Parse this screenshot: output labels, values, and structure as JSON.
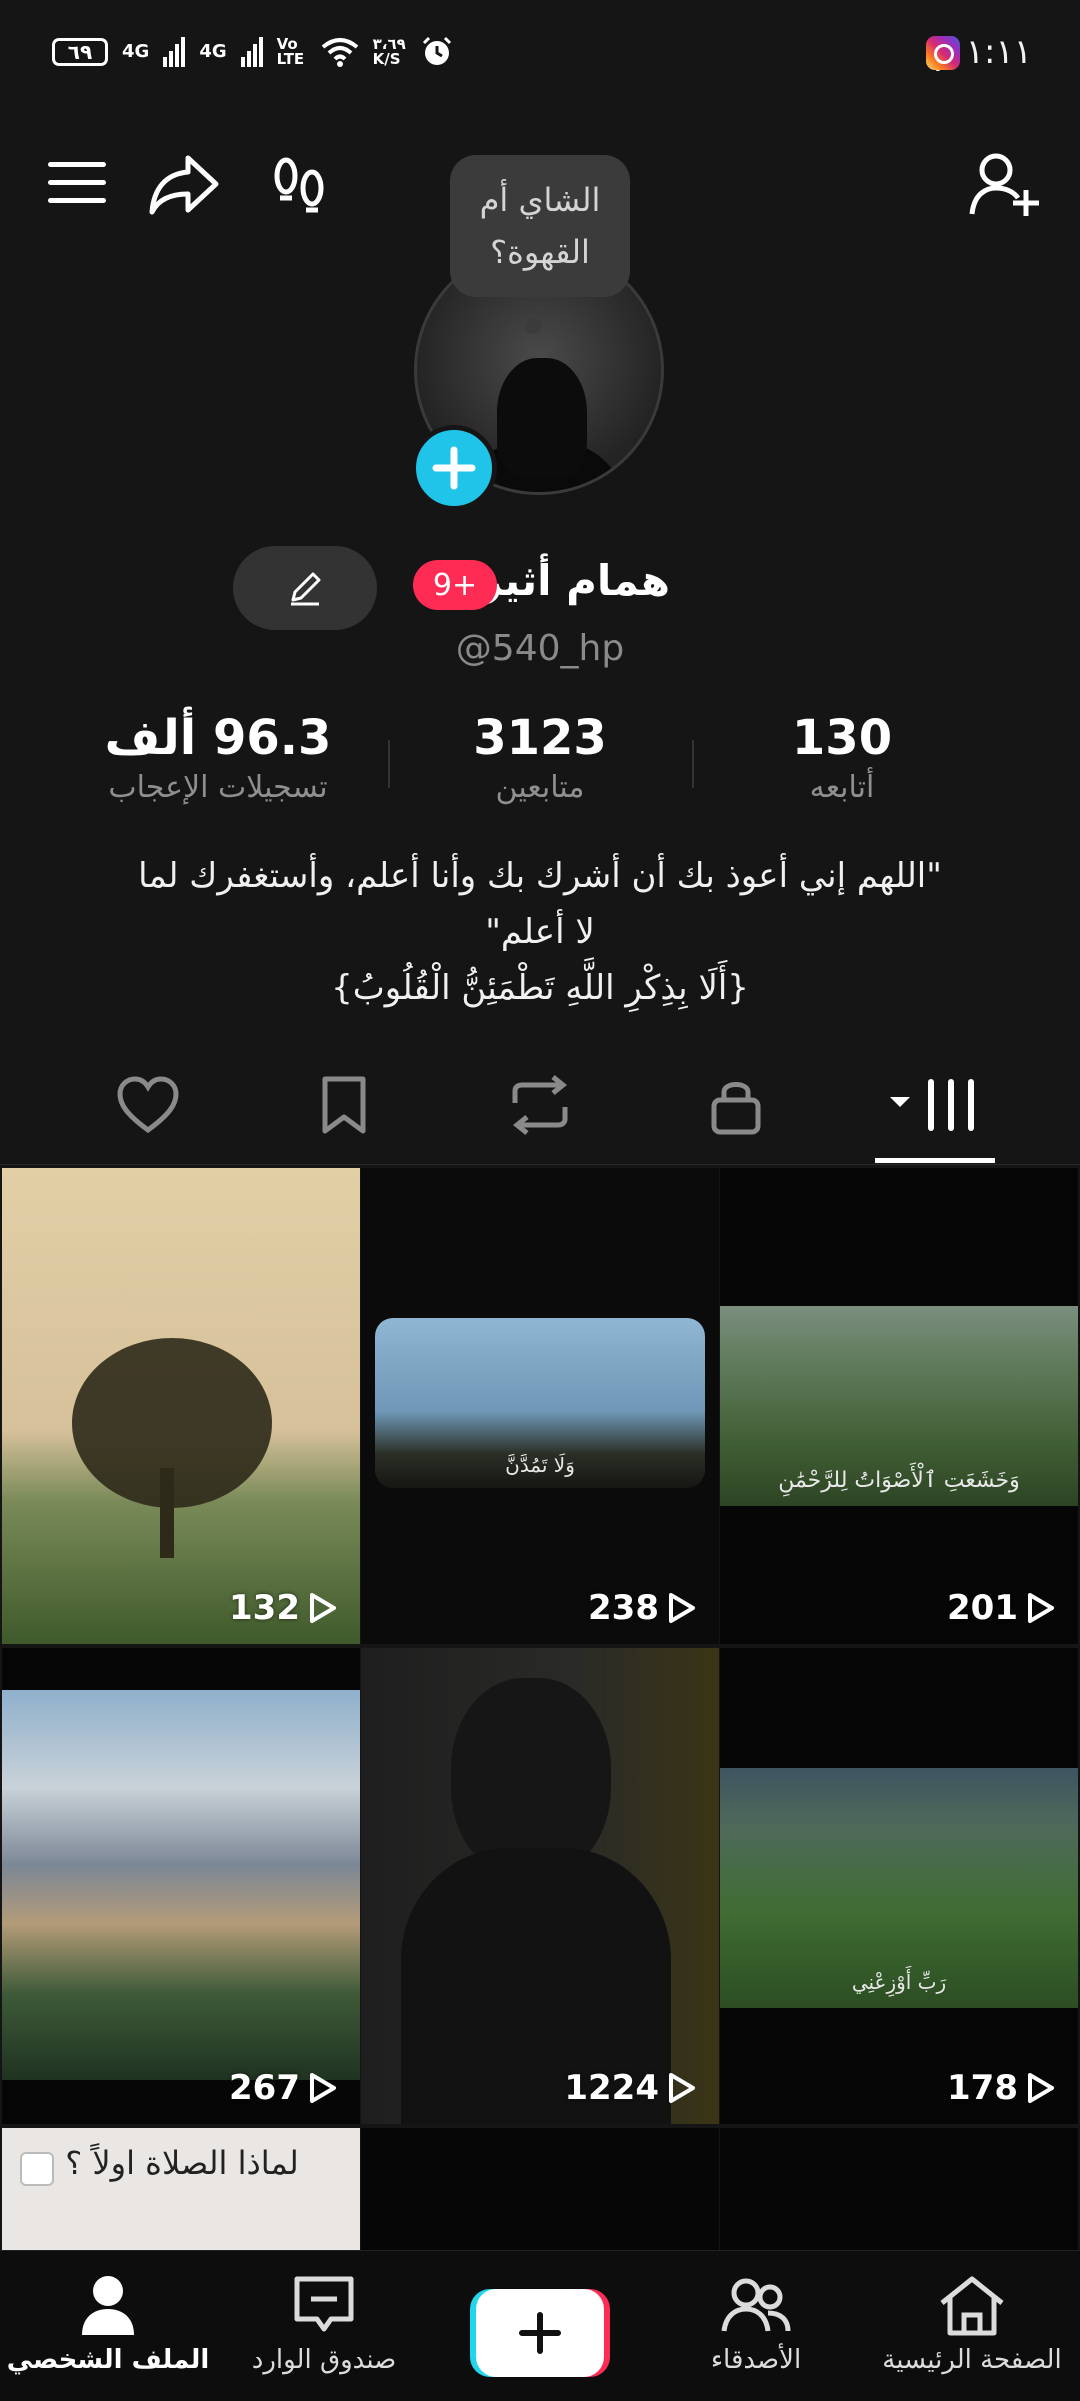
{
  "status_bar": {
    "time": "١:١١ م",
    "battery": "٦٩",
    "network1": "4G",
    "network2": "4G",
    "volte": "Vo LTE",
    "speed": "٣،٦٩ K/S"
  },
  "profile": {
    "note": "الشاي أم القهوة؟",
    "note_line1": "الشاي أم",
    "note_line2": "القهوة؟",
    "name": "همام أثير",
    "badge": "9+",
    "username": "@540_hp"
  },
  "stats": {
    "following_count": "130",
    "following_label": "أتابعه",
    "followers_count": "3123",
    "followers_label": "متابعين",
    "likes_count": "96.3 ألف",
    "likes_label": "تسجيلات الإعجاب"
  },
  "bio": {
    "line1": "\"اللهم إني أعوذ بك أن أشرك بك وأنا أعلم، وأستغفرك لما",
    "line2": "لا أعلم\"",
    "line3": "{أَلَا بِذِكْرِ اللَّهِ تَطْمَئِنُّ الْقُلُوبُ}"
  },
  "tabs": [
    "videos-grid",
    "private",
    "reposts",
    "favorites",
    "liked"
  ],
  "videos": [
    {
      "views": "201",
      "caption": "وَخَشَعَتِ ٱلْأَصْوَاتُ لِلرَّحْمَٰنِ"
    },
    {
      "views": "238",
      "caption": "وَلَا تَمُدَّنَّ"
    },
    {
      "views": "132"
    },
    {
      "views": "178",
      "caption": "رَبِّ أَوْزِعْنِي"
    },
    {
      "views": "1224"
    },
    {
      "views": "267"
    },
    {
      "caption": "لماذا الصلاة اولاً ؟"
    }
  ],
  "nav": {
    "home": "الصفحة الرئيسية",
    "friends": "الأصدقاء",
    "inbox": "صندوق الوارد",
    "profile": "الملف الشخصي"
  }
}
